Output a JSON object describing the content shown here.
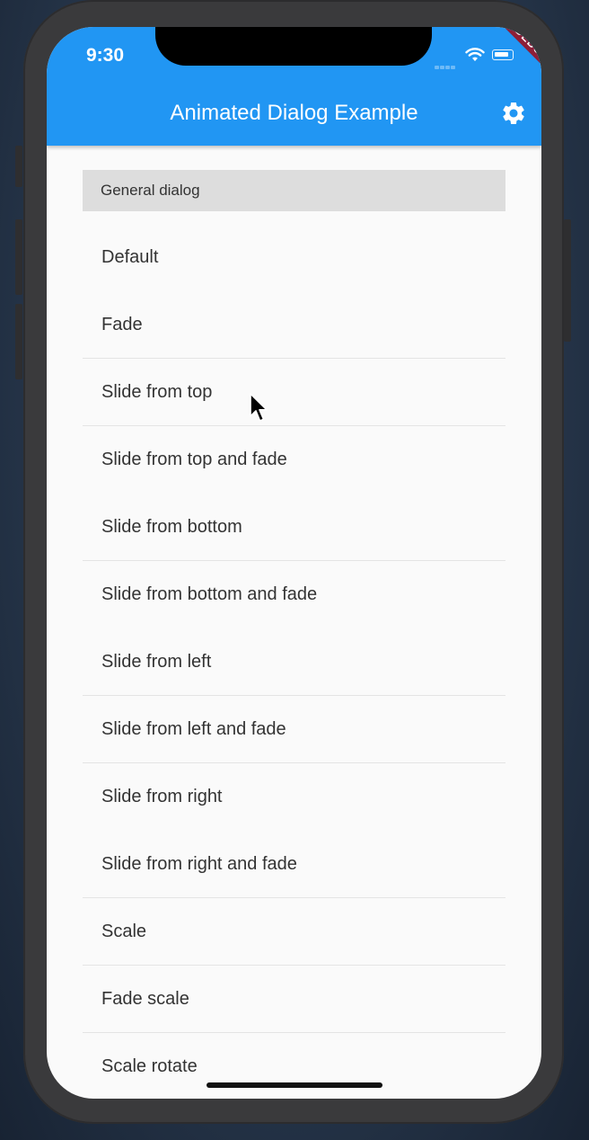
{
  "status_bar": {
    "time": "9:30"
  },
  "debug_banner": "DEBUG",
  "app_bar": {
    "title": "Animated Dialog Example",
    "settings_icon": "gear-icon",
    "color": "#2196f3"
  },
  "section": {
    "header": "General dialog"
  },
  "items": [
    {
      "label": "Default"
    },
    {
      "label": "Fade"
    },
    {
      "label": "Slide from top"
    },
    {
      "label": "Slide from top and fade"
    },
    {
      "label": "Slide from bottom"
    },
    {
      "label": "Slide from bottom and fade"
    },
    {
      "label": "Slide from left"
    },
    {
      "label": "Slide from left and fade"
    },
    {
      "label": "Slide from right"
    },
    {
      "label": "Slide from right and fade"
    },
    {
      "label": "Scale"
    },
    {
      "label": "Fade scale"
    },
    {
      "label": "Scale rotate"
    }
  ]
}
